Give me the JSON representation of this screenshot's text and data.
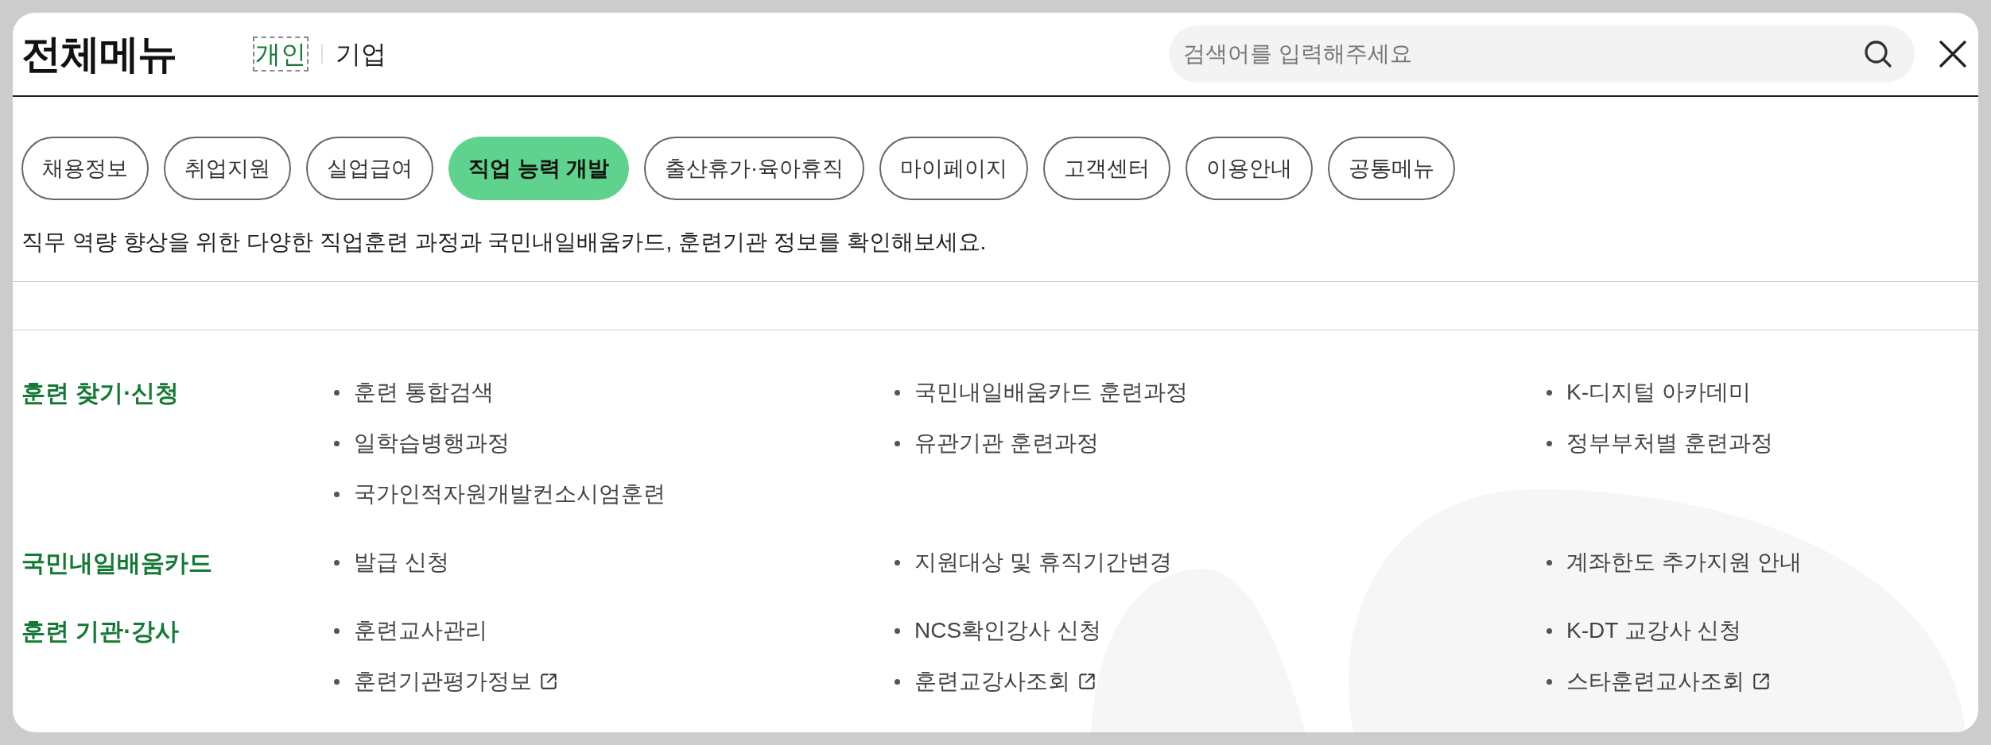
{
  "title": "전체메뉴",
  "tabs": [
    {
      "label": "개인",
      "selected": true
    },
    {
      "label": "기업",
      "selected": false
    }
  ],
  "search": {
    "placeholder": "검색어를 입력해주세요"
  },
  "categories": [
    {
      "label": "채용정보",
      "selected": false
    },
    {
      "label": "취업지원",
      "selected": false
    },
    {
      "label": "실업급여",
      "selected": false
    },
    {
      "label": "직업 능력 개발",
      "selected": true
    },
    {
      "label": "출산휴가·육아휴직",
      "selected": false
    },
    {
      "label": "마이페이지",
      "selected": false
    },
    {
      "label": "고객센터",
      "selected": false
    },
    {
      "label": "이용안내",
      "selected": false
    },
    {
      "label": "공통메뉴",
      "selected": false
    }
  ],
  "description": "직무 역량 향상을 위한 다양한 직업훈련 과정과 국민내일배움카드, 훈련기관 정보를 확인해보세요.",
  "sections": [
    {
      "heading": "훈련 찾기·신청",
      "items": [
        {
          "label": "훈련 통합검색",
          "external": false
        },
        {
          "label": "국민내일배움카드 훈련과정",
          "external": false
        },
        {
          "label": "K-디지털 아카데미",
          "external": false
        },
        {
          "label": "일학습병행과정",
          "external": false
        },
        {
          "label": "유관기관 훈련과정",
          "external": false
        },
        {
          "label": "정부부처별 훈련과정",
          "external": false
        },
        {
          "label": "국가인적자원개발컨소시엄훈련",
          "external": false
        }
      ]
    },
    {
      "heading": "국민내일배움카드",
      "items": [
        {
          "label": "발급 신청",
          "external": false
        },
        {
          "label": "지원대상 및 휴직기간변경",
          "external": false
        },
        {
          "label": "계좌한도 추가지원 안내",
          "external": false
        }
      ]
    },
    {
      "heading": "훈련 기관·강사",
      "items": [
        {
          "label": "훈련교사관리",
          "external": false
        },
        {
          "label": "NCS확인강사 신청",
          "external": false
        },
        {
          "label": "K-DT 교강사 신청",
          "external": false
        },
        {
          "label": "훈련기관평가정보",
          "external": true
        },
        {
          "label": "훈련교강사조회",
          "external": true
        },
        {
          "label": "스타훈련교사조회",
          "external": true
        }
      ]
    }
  ]
}
